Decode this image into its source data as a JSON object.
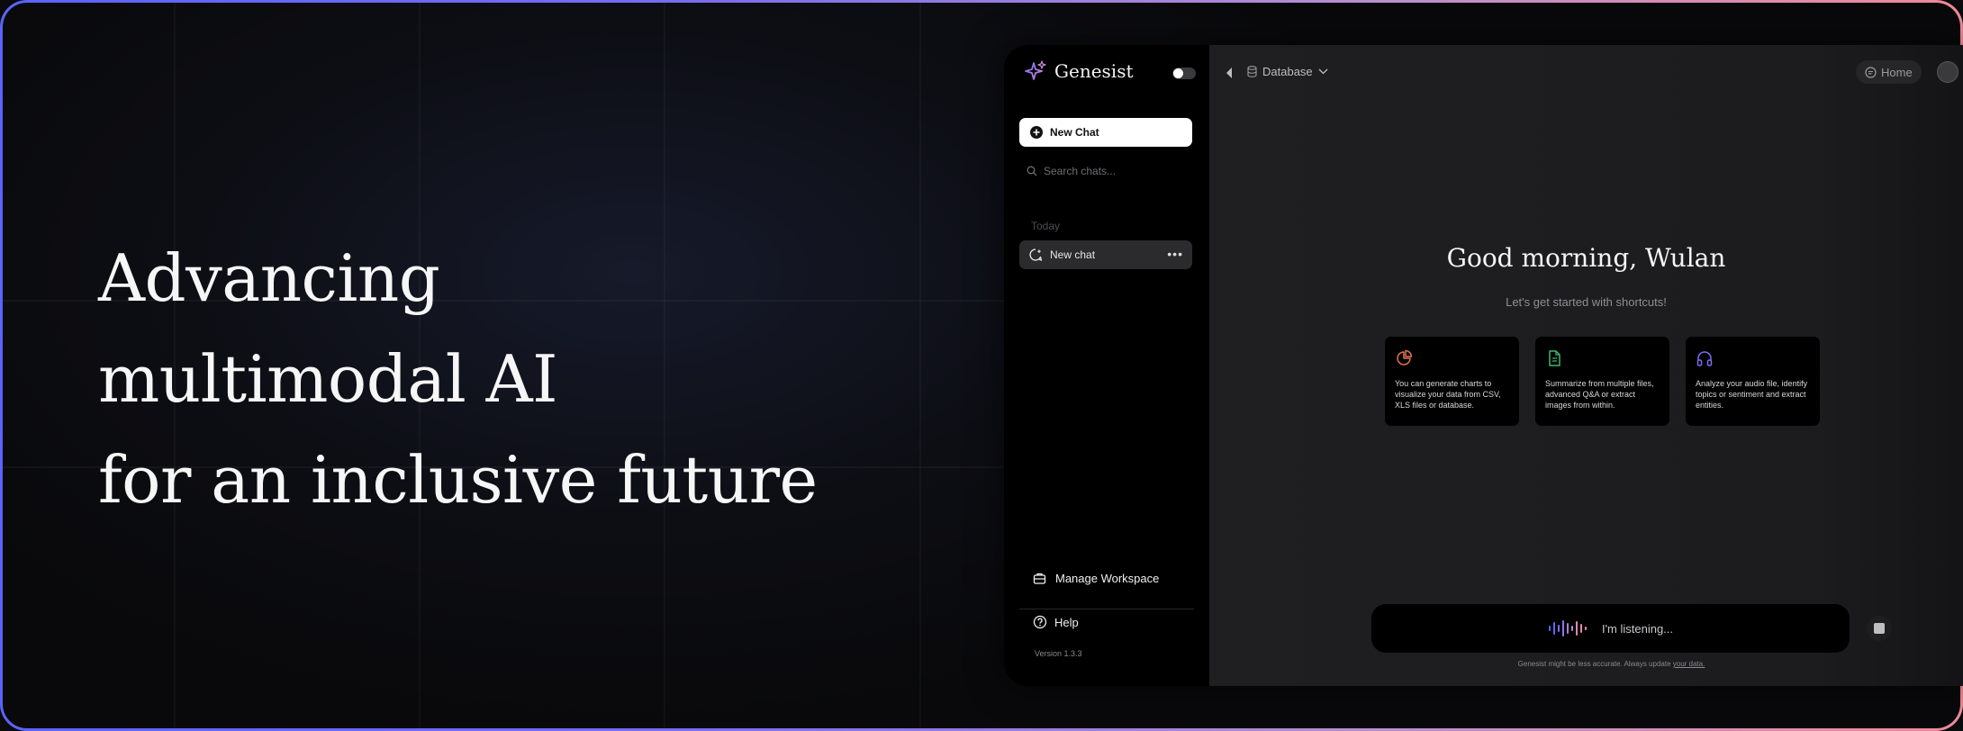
{
  "hero": {
    "line1": "Advancing",
    "line2": "multimodal AI",
    "line3": "for an inclusive future"
  },
  "app": {
    "brand": "Genesist",
    "sidebar": {
      "new_chat_label": "New Chat",
      "search_placeholder": "Search chats...",
      "section_today": "Today",
      "chats": [
        {
          "label": "New chat"
        }
      ],
      "manage_workspace": "Manage Workspace",
      "help": "Help",
      "version": "Version 1.3.3"
    },
    "topbar": {
      "source_selector": "Database",
      "home_label": "Home"
    },
    "main": {
      "greeting": "Good morning, Wulan",
      "subtitle": "Let's get started with shortcuts!",
      "cards": [
        {
          "icon": "pie-chart-icon",
          "text": "You can generate charts to visualize your data from CSV, XLS files or database."
        },
        {
          "icon": "document-icon",
          "text": "Summarize from multiple files, advanced Q&A or extract images from within."
        },
        {
          "icon": "headphones-icon",
          "text": "Analyze your audio file, identify topics or sentiment and extract entities."
        }
      ],
      "composer_status": "I'm listening...",
      "disclaimer_text": "Genesist might be less accurate. Always update ",
      "disclaimer_link": "your data."
    }
  },
  "colors": {
    "frame_gradient_start": "#5b63ff",
    "frame_gradient_end": "#f08a9a",
    "card1_icon": "#e0744f",
    "card2_icon": "#3fb86a",
    "card3_icon": "#7b6cf5"
  }
}
